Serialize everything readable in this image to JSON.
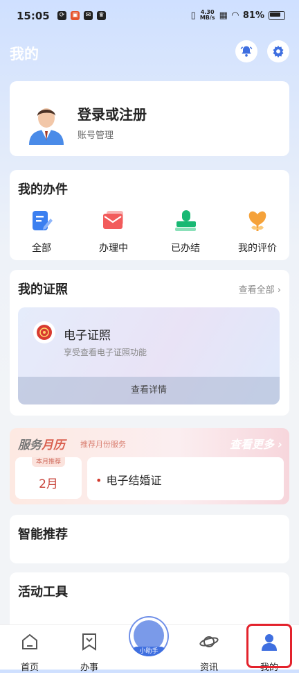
{
  "status_bar": {
    "time": "15:05",
    "network_speed_value": "4.30",
    "network_speed_unit": "MB/s",
    "battery": "81%"
  },
  "header": {
    "title": "我的",
    "icons": [
      "bell-icon",
      "gear-icon"
    ]
  },
  "user": {
    "login_label": "登录或注册",
    "account_label": "账号管理"
  },
  "my_works": {
    "title": "我的办件",
    "items": [
      {
        "label": "全部",
        "icon": "edit-document-icon",
        "color": "#3b7ff0"
      },
      {
        "label": "办理中",
        "icon": "mail-icon",
        "color": "#f25b5b"
      },
      {
        "label": "已办结",
        "icon": "stamp-icon",
        "color": "#18b873"
      },
      {
        "label": "我的评价",
        "icon": "flower-icon",
        "color": "#f5a23a"
      }
    ]
  },
  "licenses": {
    "title": "我的证照",
    "view_all": "查看全部",
    "card_title": "电子证照",
    "card_sub": "享受查看电子证照功能",
    "detail_button": "查看详情"
  },
  "service_calendar": {
    "title_part1": "服务",
    "title_part2": "月历",
    "subtitle": "推荐月份服务",
    "more": "查看更多",
    "badge": "本月推荐",
    "month": "2月",
    "items": [
      "电子结婚证"
    ]
  },
  "recommend": {
    "title": "智能推荐"
  },
  "activity": {
    "title": "活动工具"
  },
  "tabbar": {
    "items": [
      {
        "label": "首页",
        "icon": "home-icon"
      },
      {
        "label": "办事",
        "icon": "bookmark-icon"
      },
      {
        "label": "资讯",
        "icon": "planet-icon"
      },
      {
        "label": "我的",
        "icon": "person-icon",
        "active": true
      }
    ],
    "helper_label": "小助手",
    "active_color": "#3f6fe0"
  }
}
